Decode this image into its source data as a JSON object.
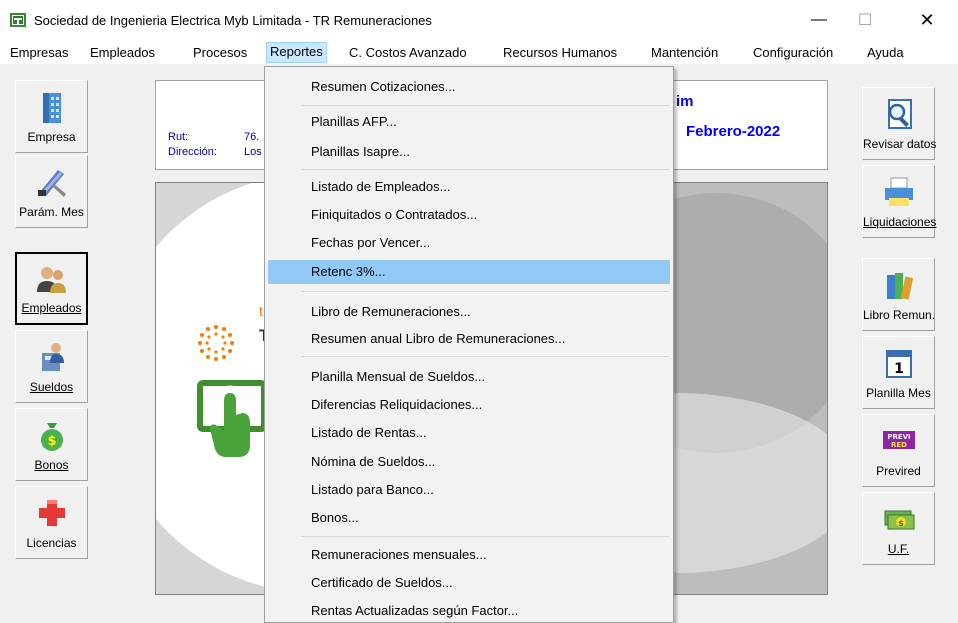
{
  "window": {
    "title": "Sociedad de Ingenieria Electrica Myb Limitada - TR Remuneraciones",
    "minimize": "—",
    "maximize": "☐",
    "close": "✕"
  },
  "menubar": {
    "items": [
      "Empresas",
      "Empleados",
      "Procesos",
      "Reportes",
      "C. Costos Avanzado",
      "Recursos Humanos",
      "Mantención",
      "Configuración",
      "Ayuda"
    ],
    "active": "Reportes"
  },
  "left_buttons": [
    {
      "label": "Empresa",
      "icon": "building-icon"
    },
    {
      "label": "Parám. Mes",
      "icon": "tools-icon"
    },
    {
      "label": "Empleados",
      "icon": "people-icon",
      "pressed": true
    },
    {
      "label": "Sueldos",
      "icon": "calculator-person-icon"
    },
    {
      "label": "Bonos",
      "icon": "money-bag-icon"
    },
    {
      "label": "Licencias",
      "icon": "red-cross-icon"
    }
  ],
  "right_buttons": [
    {
      "label": "Revisar datos",
      "icon": "magnifier-document-icon"
    },
    {
      "label": "Liquidaciones",
      "icon": "printer-icon"
    },
    {
      "label": "Libro Remun.",
      "icon": "books-icon"
    },
    {
      "label": "Planilla Mes",
      "icon": "calendar-icon",
      "calendar_day": "1"
    },
    {
      "label": "Previred",
      "icon": "previred-logo-icon",
      "logo_text": "PREVI RED"
    },
    {
      "label": "U.F.",
      "icon": "money-stack-icon"
    }
  ],
  "info": {
    "rut_label": "Rut:",
    "rut_value": "76.",
    "direccion_label": "Dirección:",
    "direccion_value": "Los",
    "company_fragment": "im",
    "period": "Febrero-2022"
  },
  "main_logo_letters": {
    "t": "t",
    "T": "T"
  },
  "dropdown": {
    "items": [
      {
        "label": "Resumen Cotizaciones..."
      },
      {
        "separator": true
      },
      {
        "label": "Planillas AFP..."
      },
      {
        "label": "Planillas Isapre..."
      },
      {
        "separator": true
      },
      {
        "label": "Listado de Empleados..."
      },
      {
        "label": "Finiquitados o Contratados..."
      },
      {
        "label": "Fechas por Vencer..."
      },
      {
        "label": "Retenc 3%...",
        "highlighted": true
      },
      {
        "separator": true
      },
      {
        "label": "Libro de Remuneraciones..."
      },
      {
        "label": "Resumen anual Libro de Remuneraciones..."
      },
      {
        "separator": true
      },
      {
        "label": "Planilla Mensual de Sueldos..."
      },
      {
        "label": "Diferencias Reliquidaciones..."
      },
      {
        "label": "Listado de Rentas..."
      },
      {
        "label": "Nómina de Sueldos..."
      },
      {
        "label": "Listado para Banco..."
      },
      {
        "label": "Bonos..."
      },
      {
        "separator": true
      },
      {
        "label": "Remuneraciones mensuales..."
      },
      {
        "label": "Certificado de Sueldos..."
      },
      {
        "label": "Rentas Actualizadas según Factor..."
      }
    ]
  },
  "colors": {
    "menu_highlight": "#91c9f7",
    "menubar_active": "#cce8ff",
    "info_text": "#0000ff"
  }
}
